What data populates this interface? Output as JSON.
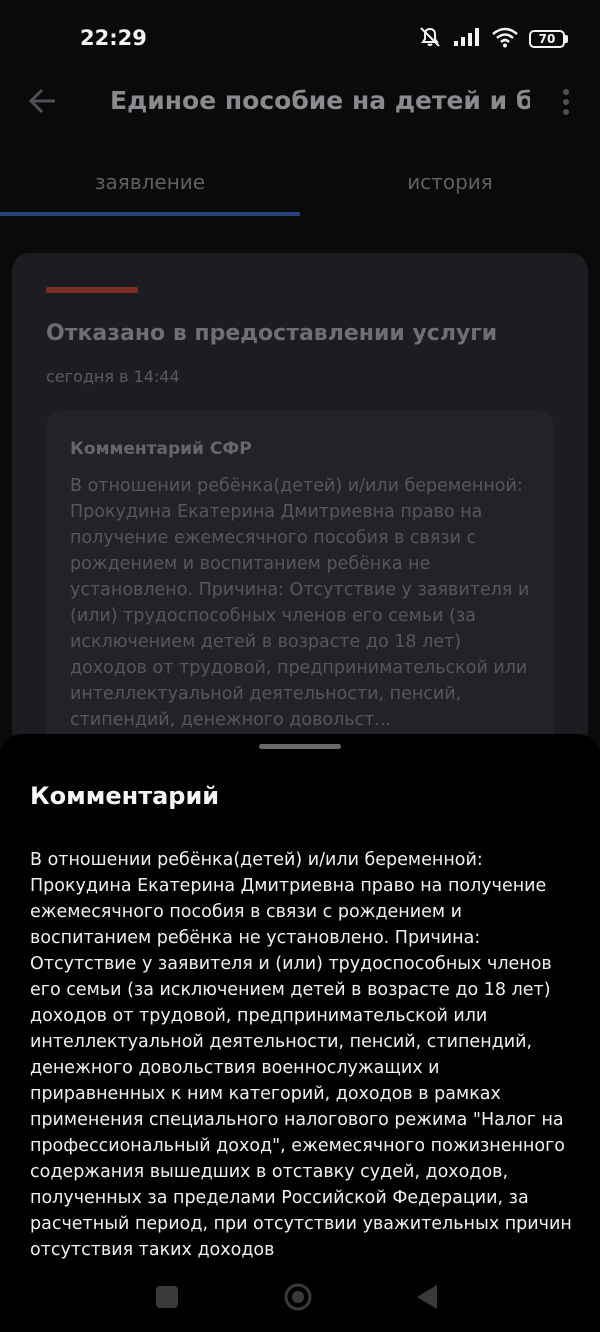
{
  "status_bar": {
    "time": "22:29",
    "battery": "70"
  },
  "app_bar": {
    "title": "Единое пособие на детей и бер..."
  },
  "tabs": [
    {
      "label": "заявление",
      "active": true
    },
    {
      "label": "история",
      "active": false
    }
  ],
  "card": {
    "status": "Отказано в предоставлении услуги",
    "time": "сегодня в 14:44",
    "status_color": "#7a2e22",
    "comment_title": "Комментарий СФР",
    "comment_preview": "В отношении ребёнка(детей) и/или беременной: Прокудина Екатерина Дмитриевна право на получение ежемесячного пособия в связи с рождением и воспитанием ребёнка не установлено. Причина: Отсутствие у заявителя и (или) трудоспособных членов его семьи (за исключением детей в возрасте до 18 лет) доходов от трудовой, предпринимательской или интеллектуальной деятельности, пенсий, стипендий, денежного довольст..."
  },
  "sheet": {
    "title": "Комментарий",
    "body": "В отношении ребёнка(детей) и/или беременной: Прокудина Екатерина Дмитриевна право на получение ежемесячного пособия в связи с рождением и воспитанием ребёнка не установлено. Причина: Отсутствие у заявителя и (или) трудоспособных членов его семьи (за исключением детей в возрасте до 18 лет) доходов от трудовой, предпринимательской или интеллектуальной деятельности, пенсий, стипендий, денежного довольствия военнослужащих и приравненных к ним категорий, доходов в рамках применения специального налогового режима \"Налог на профессиональный доход\", ежемесячного пожизненного содержания вышедших в отставку судей, доходов, полученных за пределами Российской Федерации, за расчетный период, при отсутствии уважительных причин отсутствия таких доходов"
  },
  "icons": {
    "back": "arrow-left-icon",
    "more": "more-vertical-icon",
    "mute": "bell-off-icon",
    "signal": "signal-icon",
    "wifi": "wifi-icon",
    "battery": "battery-icon"
  }
}
